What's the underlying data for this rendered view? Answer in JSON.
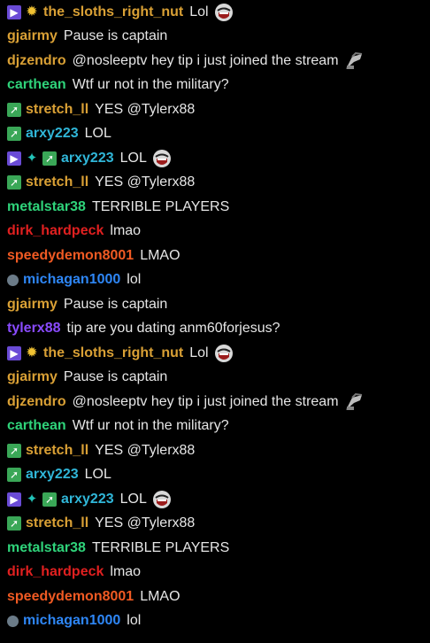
{
  "chat": {
    "messages": [
      {
        "user": "the_sloths_right_nut",
        "color": "#d9a035",
        "badges": [
          "twitch-badge",
          "star-badge"
        ],
        "text": "Lol",
        "emote": "laughing-emote"
      },
      {
        "user": "gjairmy",
        "color": "#d9a035",
        "badges": [],
        "text": "Pause is captain",
        "emote": ""
      },
      {
        "user": "djzendro",
        "color": "#d9a035",
        "badges": [],
        "text": "@nosleeptv hey tip i just joined the stream",
        "emote": "salute-emote"
      },
      {
        "user": "carthean",
        "color": "#2fd37a",
        "badges": [],
        "text": "Wtf ur not in the military?",
        "emote": ""
      },
      {
        "user": "stretch_ll",
        "color": "#d9a035",
        "badges": [
          "green-badge"
        ],
        "text": "YES @Tylerx88",
        "emote": ""
      },
      {
        "user": "arxy223",
        "color": "#30b6d8",
        "badges": [
          "green-badge"
        ],
        "text": "LOL",
        "emote": ""
      },
      {
        "user": "arxy223",
        "color": "#30b6d8",
        "badges": [
          "twitch-badge",
          "teal-star-badge",
          "green-badge"
        ],
        "text": "LOL",
        "emote": "laughing-emote"
      },
      {
        "user": "stretch_ll",
        "color": "#d9a035",
        "badges": [
          "green-badge"
        ],
        "text": "YES @Tylerx88",
        "emote": ""
      },
      {
        "user": "metalstar38",
        "color": "#2fd37a",
        "badges": [],
        "text": "TERRIBLE PLAYERS",
        "emote": ""
      },
      {
        "user": "dirk_hardpeck",
        "color": "#e02020",
        "badges": [],
        "text": "lmao",
        "emote": ""
      },
      {
        "user": "speedydemon8001",
        "color": "#f05a23",
        "badges": [],
        "text": "LMAO",
        "emote": ""
      },
      {
        "user": "michagan1000",
        "color": "#2e86f5",
        "badges": [
          "globe-badge"
        ],
        "text": "lol",
        "emote": ""
      },
      {
        "user": "gjairmy",
        "color": "#d9a035",
        "badges": [],
        "text": "Pause is captain",
        "emote": ""
      },
      {
        "user": "tylerx88",
        "color": "#8a4bff",
        "badges": [],
        "text": "tip are you dating anm60forjesus?",
        "emote": ""
      },
      {
        "user": "the_sloths_right_nut",
        "color": "#d9a035",
        "badges": [
          "twitch-badge",
          "star-badge"
        ],
        "text": "Lol",
        "emote": "laughing-emote"
      },
      {
        "user": "gjairmy",
        "color": "#d9a035",
        "badges": [],
        "text": "Pause is captain",
        "emote": ""
      },
      {
        "user": "djzendro",
        "color": "#d9a035",
        "badges": [],
        "text": "@nosleeptv hey tip i just joined the stream",
        "emote": "salute-emote"
      },
      {
        "user": "carthean",
        "color": "#2fd37a",
        "badges": [],
        "text": "Wtf ur not in the military?",
        "emote": ""
      },
      {
        "user": "stretch_ll",
        "color": "#d9a035",
        "badges": [
          "green-badge"
        ],
        "text": "YES @Tylerx88",
        "emote": ""
      },
      {
        "user": "arxy223",
        "color": "#30b6d8",
        "badges": [
          "green-badge"
        ],
        "text": "LOL",
        "emote": ""
      },
      {
        "user": "arxy223",
        "color": "#30b6d8",
        "badges": [
          "twitch-badge",
          "teal-star-badge",
          "green-badge"
        ],
        "text": "LOL",
        "emote": "laughing-emote"
      },
      {
        "user": "stretch_ll",
        "color": "#d9a035",
        "badges": [
          "green-badge"
        ],
        "text": "YES @Tylerx88",
        "emote": ""
      },
      {
        "user": "metalstar38",
        "color": "#2fd37a",
        "badges": [],
        "text": "TERRIBLE PLAYERS",
        "emote": ""
      },
      {
        "user": "dirk_hardpeck",
        "color": "#e02020",
        "badges": [],
        "text": "lmao",
        "emote": ""
      },
      {
        "user": "speedydemon8001",
        "color": "#f05a23",
        "badges": [],
        "text": "LMAO",
        "emote": ""
      },
      {
        "user": "michagan1000",
        "color": "#2e86f5",
        "badges": [
          "globe-badge"
        ],
        "text": "lol",
        "emote": ""
      }
    ]
  }
}
